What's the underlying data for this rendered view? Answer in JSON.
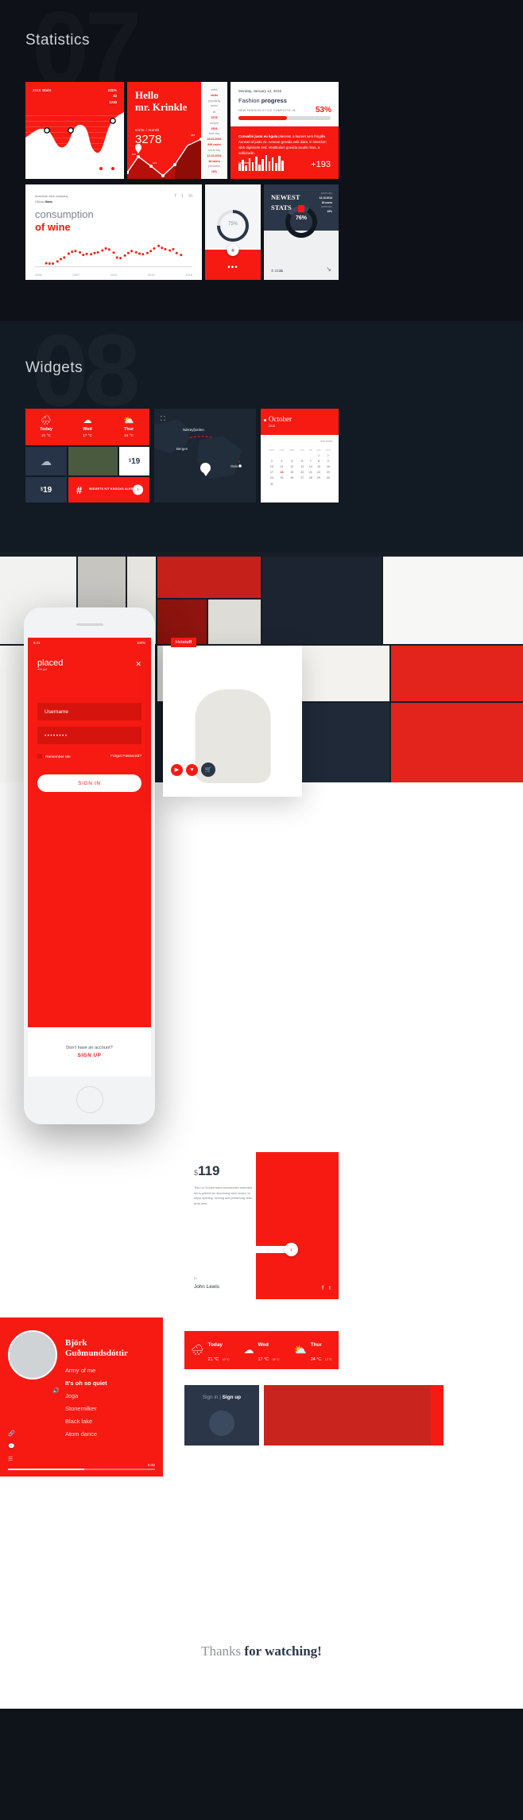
{
  "sections": {
    "statistics": {
      "number": "07",
      "title": "Statistics"
    },
    "widgets": {
      "number": "08",
      "title": "Widgets"
    }
  },
  "stats_cards": {
    "wave": {
      "header_year": "2015",
      "header_label": "Stats",
      "metrics": [
        "231%",
        "33",
        "1234"
      ]
    },
    "hello": {
      "greeting_line1": "Hello",
      "greeting_line2": "mr. Krinkle",
      "visits_label": "visits / month",
      "visits_value": "3278",
      "sidebar_top": [
        "sales",
        "visits",
        "popularity",
        "ranks"
      ],
      "sidebar_stats": [
        {
          "key": "all",
          "value": "3278"
        },
        {
          "key": "unique",
          "value": "2528"
        },
        {
          "key": "best day",
          "value": "18.10.2016"
        },
        {
          "key": "",
          "value": "949 users"
        },
        {
          "key": "worst day",
          "value": "12.10.2014"
        },
        {
          "key": "",
          "value": "18 users"
        },
        {
          "key": "prediction",
          "value": "19%"
        }
      ],
      "chart_labels": [
        "114",
        "101",
        "845"
      ]
    },
    "fashion": {
      "date": "Monday, January 12, 2015",
      "title_light": "Fashion",
      "title_bold": "progress",
      "progress_label": "NEW FASHION STYLE COMPLETE IN:",
      "percent": "53",
      "percent_symbol": "%",
      "progress_value": 53,
      "body_bold": "Convallis justo eu ligula",
      "body_text": "placerat, a laoreet sem fringilla. Aenean id justo mi. Aenean gravida velit diam, in interdum nibh dignissim sed. Vestibulum gravida iaculis risus, a sollicitudin.",
      "inquiries_label": "inquiries",
      "inquiries_delta": "+193"
    },
    "wine": {
      "company": "American wine company",
      "official_light": "Official",
      "official_bold": "Stats",
      "heading_light": "consumption",
      "heading_bold": "of wine",
      "social": [
        "f",
        "t",
        "in"
      ]
    },
    "gauge": {
      "value": "75",
      "symbol": "%",
      "add_icon": "+",
      "more_icon": "•••"
    },
    "newest": {
      "title_line1": "NEWEST",
      "title_line2": "STATS",
      "meta": [
        {
          "key": "worst day",
          "value": "12.10.2014"
        },
        {
          "key": "",
          "value": "18 users"
        },
        {
          "key": "prediction",
          "value": "19%"
        }
      ],
      "donut_value": "76%",
      "clock_label": "23",
      "clock_bold": "21"
    }
  },
  "chart_data": [
    {
      "type": "area",
      "title": "2015 Stats",
      "id": "wave-card",
      "x": [
        0,
        1,
        2,
        3,
        4,
        5,
        6,
        7,
        8,
        9,
        10
      ],
      "values": [
        52,
        40,
        30,
        55,
        72,
        70,
        48,
        30,
        22,
        55,
        86
      ],
      "ylim": [
        0,
        100
      ],
      "grid": true,
      "markers": [
        1,
        3,
        9
      ]
    },
    {
      "type": "line",
      "title": "visits / month",
      "id": "hello-card",
      "categories": [
        "1",
        "2",
        "3",
        "4",
        "5",
        "6",
        "7"
      ],
      "values": [
        20,
        55,
        38,
        12,
        30,
        62,
        80
      ],
      "point_labels": [
        "",
        "114",
        "101",
        "",
        "",
        "",
        "845"
      ],
      "ylabel": "visits",
      "ylim": [
        0,
        100
      ]
    },
    {
      "type": "bar",
      "title": "inquiries",
      "id": "fashion-inquiries",
      "values": [
        9,
        14,
        7,
        16,
        11,
        18,
        8,
        15,
        20,
        12,
        17,
        10,
        19,
        13
      ],
      "ylim": [
        0,
        20
      ],
      "annotation": "+193"
    },
    {
      "type": "scatter",
      "title": "consumption of wine",
      "id": "wine-card",
      "xlabel": "",
      "ylabel": "",
      "tick_labels": [
        "2004",
        "2007",
        "2010",
        "2013",
        "2016"
      ],
      "xlim": [
        2003,
        2017
      ],
      "ylim": [
        0,
        100
      ],
      "x": [
        2004,
        2004.3,
        2004.6,
        2005,
        2005.3,
        2005.6,
        2006,
        2006.3,
        2006.6,
        2007,
        2007.3,
        2007.6,
        2008,
        2008.3,
        2008.6,
        2009,
        2009.3,
        2009.6,
        2010,
        2010.3,
        2010.6,
        2011,
        2011.3,
        2011.6,
        2012,
        2012.3,
        2012.6,
        2013,
        2013.3,
        2013.6,
        2014,
        2014.3,
        2014.6,
        2015,
        2015.3,
        2015.6,
        2016
      ],
      "values": [
        12,
        11,
        11,
        18,
        25,
        30,
        42,
        48,
        50,
        46,
        38,
        41,
        40,
        44,
        46,
        52,
        58,
        55,
        45,
        30,
        28,
        36,
        44,
        50,
        46,
        42,
        40,
        44,
        50,
        58,
        66,
        60,
        56,
        52,
        56,
        44,
        38
      ],
      "grid": false
    },
    {
      "type": "pie",
      "title": "75%",
      "id": "gauge-card",
      "categories": [
        "complete",
        "remaining"
      ],
      "values": [
        75,
        25
      ],
      "colors": [
        "#2b3648",
        "#dfe2e5"
      ]
    },
    {
      "type": "pie",
      "title": "76%",
      "id": "newest-stats-donut",
      "categories": [
        "complete",
        "remaining"
      ],
      "values": [
        76,
        24
      ],
      "colors": [
        "#111820",
        "#3c4658"
      ]
    }
  ],
  "widgets": {
    "weather_small": [
      {
        "day": "Today",
        "temp": "21 °C",
        "icon": "rain-icon"
      },
      {
        "day": "Wed",
        "temp": "17 °C",
        "icon": "cloud-icon"
      },
      {
        "day": "Thur",
        "temp": "24 °C",
        "icon": "sun-cloud-icon"
      }
    ],
    "cloud_tile_icon": "cloud-download-icon",
    "price_tile_1": {
      "currency": "$",
      "amount": "19"
    },
    "price_tile_2": {
      "currency": "$",
      "amount": "19"
    },
    "promo": {
      "hash": "#",
      "text": "WIDGETS KIT KNOCKS ALERT",
      "cta_icon": "arrow-right-icon"
    },
    "map": {
      "expand_icon": "expand-icon",
      "labels": [
        "Nærøyfjorden",
        "Bergen",
        "Oslo"
      ],
      "pin_icon": "map-pin-icon"
    },
    "calendar": {
      "month": "October",
      "year": "2016",
      "add_label": "Add event",
      "weekdays": [
        "MON",
        "TUE",
        "WED",
        "THU",
        "FRI",
        "SAT",
        "SUN"
      ],
      "weeks": [
        [
          "",
          "",
          "",
          "",
          "",
          "1",
          "2"
        ],
        [
          "3",
          "4",
          "5",
          "6",
          "7",
          "8",
          "9"
        ],
        [
          "10",
          "11",
          "12",
          "13",
          "14",
          "15",
          "16"
        ],
        [
          "17",
          "18",
          "19",
          "20",
          "21",
          "22",
          "23"
        ],
        [
          "24",
          "25",
          "26",
          "27",
          "28",
          "29",
          "30"
        ],
        [
          "31",
          "",
          "",
          "",
          "",
          "",
          ""
        ]
      ],
      "highlight": "18"
    }
  },
  "phone": {
    "status_time": "9:41",
    "status_battery": "100%",
    "brand": "placed",
    "brand_sub": "let's go!",
    "close_icon": "close-icon",
    "username_value": "Username",
    "password_value": "••••••••",
    "remember_label": "Remember Me",
    "forgot_label": "Forgot Password?",
    "signin_label": "SIGN IN",
    "no_account": "Don't have an account?",
    "signup_label": "SIGN UP"
  },
  "product": {
    "tag_light": "Hot",
    "tag_bold": "stuff",
    "play_icon": "play-icon",
    "like_icon": "heart-icon",
    "cart_icon": "cart-icon"
  },
  "wine_price": {
    "currency": "$",
    "amount": "119",
    "description": "This La Crouzel wine accessories essential set is perfect for discerning wine lovers, to enjoy opening, serving and preserving wine at its best.",
    "by_label": "BY",
    "by_name": "John Lewis",
    "next_icon": "arrow-right-icon",
    "social": [
      "f",
      "t"
    ]
  },
  "music": {
    "artist_line1": "Björk",
    "artist_line2": "Guðmundsdóttir",
    "tracks": [
      {
        "title": "Army of me",
        "playing": false
      },
      {
        "title": "It's oh so quiet",
        "playing": true
      },
      {
        "title": "Joga",
        "playing": false
      },
      {
        "title": "Stonemilker",
        "playing": false
      },
      {
        "title": "Black lake",
        "playing": false
      },
      {
        "title": "Atom dance",
        "playing": false
      }
    ],
    "playing_icon": "speaker-icon",
    "side_icons": [
      "link-icon",
      "comment-icon",
      "list-icon"
    ],
    "duration": "5:32",
    "progress": 52
  },
  "weather_strip": [
    {
      "day": "Today",
      "temp": "21 °C",
      "low": "10 °C",
      "icon": "rain-icon"
    },
    {
      "day": "Wed",
      "temp": "17 °C",
      "low": "08 °C",
      "icon": "cloud-icon"
    },
    {
      "day": "Thur",
      "temp": "24 °C",
      "low": "13 °C",
      "icon": "sun-cloud-icon"
    }
  ],
  "signup_tile": {
    "signin_label": "Sign in",
    "signup_label": "Sign up"
  },
  "footer": {
    "thanks_light": "Thanks",
    "thanks_bold": "for watching!"
  },
  "colors": {
    "brand_red": "#f61a13",
    "dark_navy": "#2b3648",
    "page_dark": "#0e1218",
    "widgets_dark": "#121a23",
    "white": "#ffffff"
  }
}
